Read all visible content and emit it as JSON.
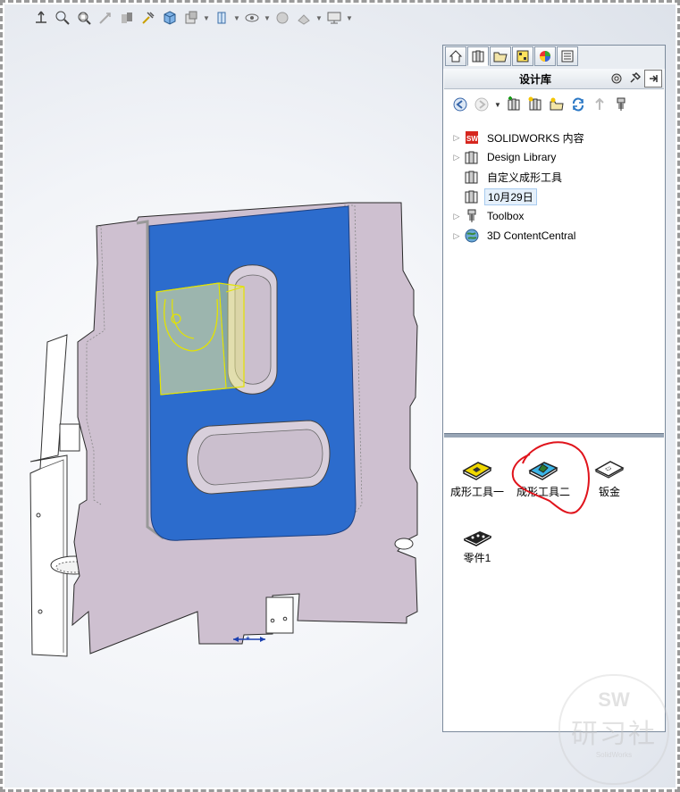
{
  "hud_icons": [
    "view-orientation-icon",
    "zoom-to-fit-icon",
    "zoom-to-area-icon",
    "previous-view-icon",
    "section-view-icon",
    "dynamic-annotation-icon",
    "view-orientation-cube-icon",
    "display-style-icon",
    "hide-show-icon",
    "edit-appearance-icon",
    "apply-scene-icon",
    "view-settings-icon"
  ],
  "task_pane": {
    "tabs": [
      "home-icon",
      "design-library-icon",
      "file-explorer-icon",
      "view-palette-icon",
      "appearances-icon",
      "custom-properties-icon"
    ],
    "title": "设计库",
    "toolbar": [
      "back-icon",
      "forward-icon",
      "add-to-library-icon",
      "add-file-location-icon",
      "create-new-folder-icon",
      "refresh-icon",
      "up-one-level-icon",
      "toolbox-icon"
    ],
    "tree": [
      {
        "label": "SOLIDWORKS 内容",
        "icon": "solidworks-content-icon",
        "expandable": true
      },
      {
        "label": "Design Library",
        "icon": "library-folder-icon",
        "expandable": true
      },
      {
        "label": "自定义成形工具",
        "icon": "library-folder-icon",
        "expandable": false
      },
      {
        "label": "10月29日",
        "icon": "library-folder-icon",
        "expandable": false,
        "selected": true
      },
      {
        "label": "Toolbox",
        "icon": "toolbox-icon",
        "expandable": true
      },
      {
        "label": "3D ContentCentral",
        "icon": "globe-icon",
        "expandable": true
      }
    ],
    "items": [
      {
        "label": "成形工具一",
        "icon": "forming-tool-icon"
      },
      {
        "label": "成形工具二",
        "icon": "forming-tool-icon",
        "circled": true
      },
      {
        "label": "钣金",
        "icon": "sheet-metal-icon"
      },
      {
        "label": "零件1",
        "icon": "part-icon"
      }
    ]
  },
  "watermark": {
    "line1": "SW",
    "line2": "研习社",
    "line3": "SolidWorks"
  },
  "colors": {
    "selected_face": "#2e6fd0",
    "part_body": "#cdbfcf",
    "annotation_circle": "#e0141c",
    "forming_tool_preview": "#f1f13a"
  }
}
